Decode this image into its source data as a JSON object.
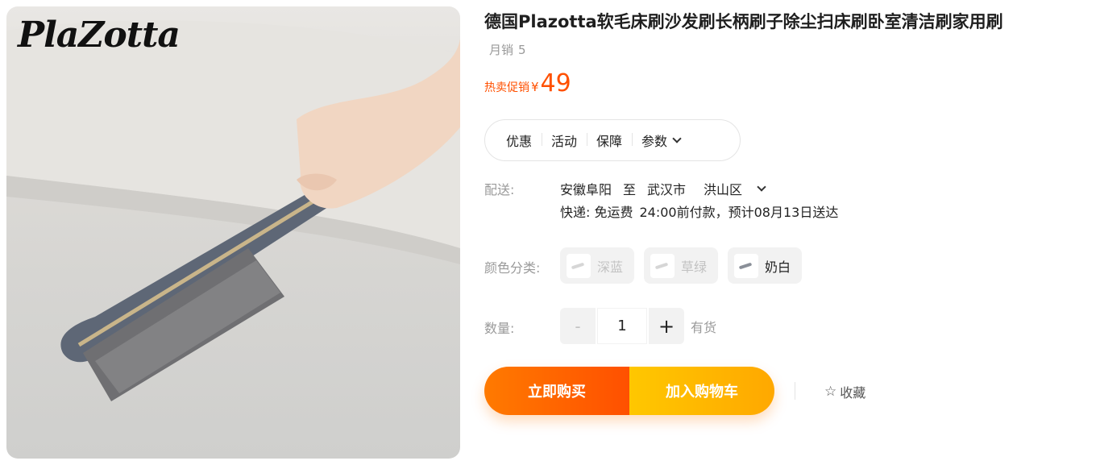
{
  "image": {
    "brand_logo": "PlaZotta"
  },
  "product": {
    "title": "德国Plazotta软毛床刷沙发刷长柄刷子除尘扫床刷卧室清洁刷家用刷",
    "sales_label": "月销",
    "sales_count": "5",
    "price_tag": "热卖促销",
    "price_currency": "¥",
    "price_value": "49"
  },
  "tabs": {
    "items": [
      {
        "label": "优惠"
      },
      {
        "label": "活动"
      },
      {
        "label": "保障"
      },
      {
        "label": "参数"
      }
    ]
  },
  "delivery": {
    "label": "配送:",
    "origin": "安徽阜阳",
    "to": "至",
    "city": "武汉市",
    "district": "洪山区",
    "courier": "快递: 免运费",
    "eta": "24:00前付款，预计08月13日送达"
  },
  "color": {
    "label": "颜色分类:",
    "options": [
      {
        "label": "深蓝",
        "available": false
      },
      {
        "label": "草绿",
        "available": false
      },
      {
        "label": "奶白",
        "available": true
      }
    ]
  },
  "quantity": {
    "label": "数量:",
    "minus": "-",
    "value": "1",
    "plus": "+",
    "stock": "有货"
  },
  "actions": {
    "buy_now": "立即购买",
    "add_to_cart": "加入购物车",
    "favorite": "收藏",
    "favorite_icon": "star-icon"
  },
  "colors": {
    "accent": "#ff5000",
    "buy_now": "#ff6a00",
    "add_cart": "#ffb800"
  }
}
